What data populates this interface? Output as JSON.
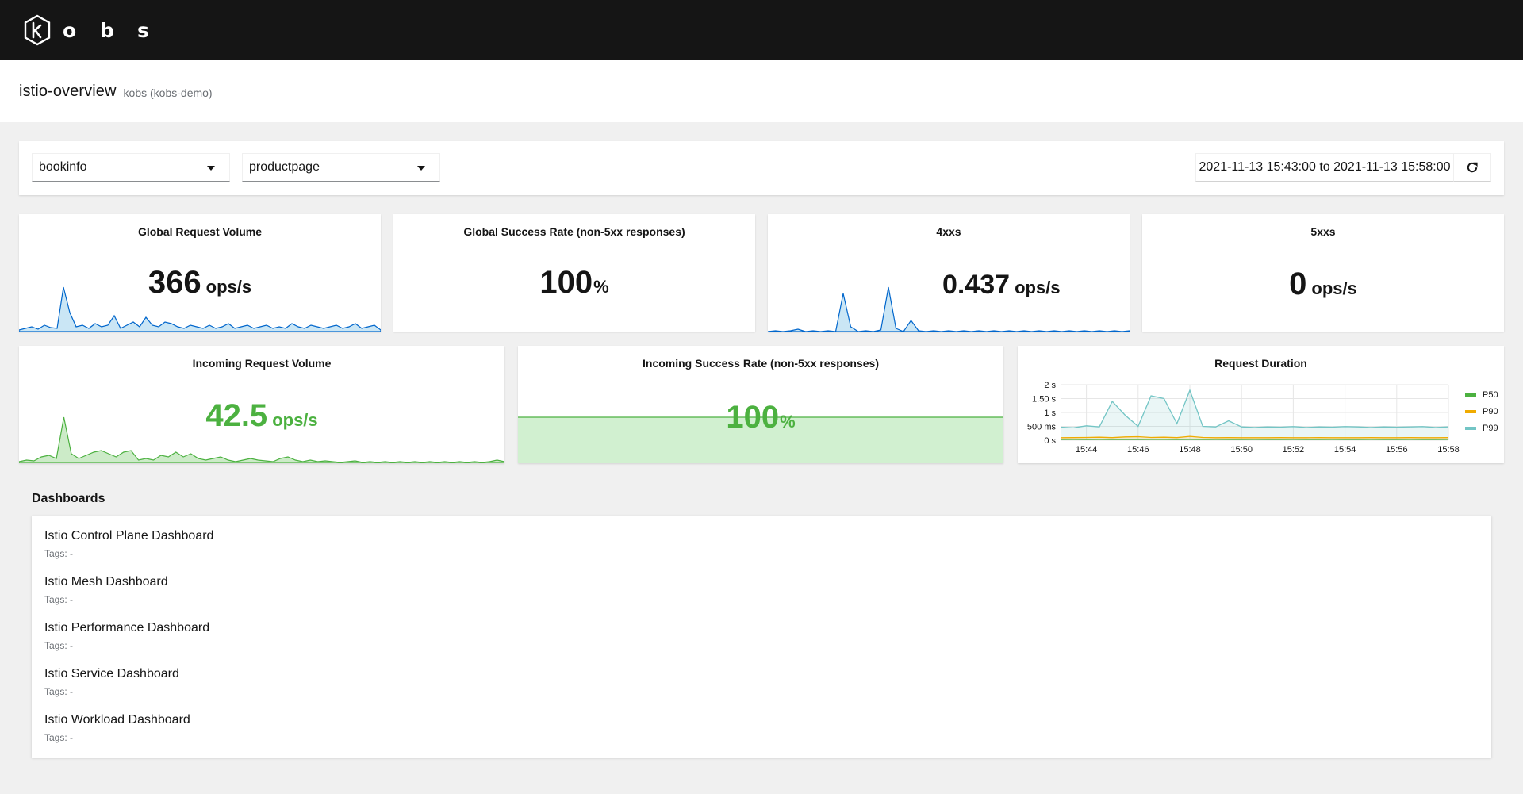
{
  "app": {
    "logo_letters": [
      "o",
      "b",
      "s"
    ]
  },
  "header": {
    "title": "istio-overview",
    "subtitle": "kobs (kobs-demo)"
  },
  "toolbar": {
    "namespace": "bookinfo",
    "application": "productpage",
    "time_range": "2021-11-13 15:43:00 to 2021-11-13 15:58:00",
    "refresh_icon": "refresh-icon"
  },
  "panels": {
    "global_volume": {
      "title": "Global Request Volume",
      "value": "366",
      "unit": "ops/s"
    },
    "global_success": {
      "title": "Global Success Rate (non-5xx responses)",
      "value": "100",
      "unit": "%"
    },
    "fourxx": {
      "title": "4xxs",
      "value": "0.437",
      "unit": "ops/s"
    },
    "fivexx": {
      "title": "5xxs",
      "value": "0",
      "unit": "ops/s"
    },
    "incoming_volume": {
      "title": "Incoming Request Volume",
      "value": "42.5",
      "unit": "ops/s"
    },
    "incoming_success": {
      "title": "Incoming Success Rate (non-5xx responses)",
      "value": "100",
      "unit": "%"
    },
    "duration": {
      "title": "Request Duration"
    }
  },
  "chart_data": {
    "type": "line",
    "title": "Request Duration",
    "x": [
      "15:43",
      "15:43:30",
      "15:44",
      "15:44:30",
      "15:45",
      "15:45:30",
      "15:46",
      "15:46:30",
      "15:47",
      "15:47:30",
      "15:48",
      "15:48:30",
      "15:49",
      "15:49:30",
      "15:50",
      "15:50:30",
      "15:51",
      "15:51:30",
      "15:52",
      "15:52:30",
      "15:53",
      "15:53:30",
      "15:54",
      "15:54:30",
      "15:55",
      "15:55:30",
      "15:56",
      "15:56:30",
      "15:57",
      "15:57:30",
      "15:58"
    ],
    "x_ticks": [
      "15:44",
      "15:46",
      "15:48",
      "15:50",
      "15:52",
      "15:54",
      "15:56",
      "15:58"
    ],
    "y_ticks": [
      "2 s",
      "1.50 s",
      "1 s",
      "500 ms",
      "0 s"
    ],
    "ylim": [
      0,
      2000
    ],
    "legend_position": "right",
    "series": [
      {
        "name": "P50",
        "color": "#4cb140",
        "values": [
          30,
          32,
          30,
          31,
          30,
          33,
          30,
          32,
          31,
          30,
          32,
          30,
          31,
          30,
          30,
          31,
          30,
          30,
          31,
          30,
          30,
          31,
          30,
          30,
          31,
          30,
          30,
          31,
          30,
          30,
          31
        ]
      },
      {
        "name": "P90",
        "color": "#f0ab00",
        "values": [
          90,
          95,
          100,
          110,
          95,
          120,
          130,
          100,
          110,
          95,
          140,
          100,
          90,
          95,
          90,
          92,
          90,
          95,
          90,
          92,
          95,
          90,
          92,
          90,
          95,
          90,
          92,
          95,
          90,
          92,
          95
        ]
      },
      {
        "name": "P99",
        "color": "#73c5c5",
        "values": [
          470,
          450,
          520,
          480,
          1400,
          900,
          500,
          1600,
          1500,
          600,
          1800,
          500,
          480,
          700,
          480,
          460,
          480,
          470,
          490,
          460,
          480,
          470,
          490,
          480,
          460,
          480,
          470,
          480,
          490,
          460,
          480
        ]
      }
    ]
  },
  "dashboards": {
    "heading": "Dashboards",
    "tags_label": "Tags:",
    "items": [
      {
        "name": "Istio Control Plane Dashboard",
        "tags": "-"
      },
      {
        "name": "Istio Mesh Dashboard",
        "tags": "-"
      },
      {
        "name": "Istio Performance Dashboard",
        "tags": "-"
      },
      {
        "name": "Istio Service Dashboard",
        "tags": "-"
      },
      {
        "name": "Istio Workload Dashboard",
        "tags": "-"
      }
    ]
  },
  "colors": {
    "masthead": "#151515",
    "blue": "#0066cc",
    "green": "#4cb140",
    "green_fill": "#d1f0d0"
  }
}
